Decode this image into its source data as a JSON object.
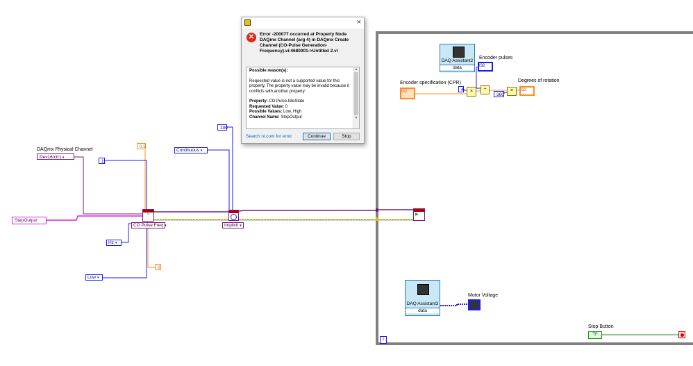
{
  "dialog": {
    "title": "",
    "close": "×",
    "error_icon": "error-x-icon",
    "message": "Error -200077 occurred at Property Node DAQmx Channel (arg 4) in DAQmx Create Channel (CO-Pulse Generation-Frequency).vi:4680001->Untitled 2.vi",
    "reasons_heading": "Possible reason(s):",
    "reason_text": "Requested value is not a supported value for this property. The property value may be invalid because it conflicts with another property.",
    "property_label": "Property:",
    "property_value": "CO.Pulse.IdleState",
    "requested_label": "Requested Value:",
    "requested_value": "0",
    "possible_label": "Possible Values:",
    "possible_value": "Low, High",
    "channel_label": "Channel Name:",
    "channel_value": "StepOutput",
    "search_link": "Search ni.com for error",
    "continue_button": "Continue",
    "stop_button": "Stop"
  },
  "diagram": {
    "physical_channel_label": "DAQmx Physical Channel",
    "physical_channel_value": "Dev16/ctr1",
    "step_output": "StepOutput",
    "const_05": "0.5",
    "const_1": "1",
    "hz_enum": "Hz",
    "low_enum": "Low",
    "const_0": "0",
    "co_pulse_freq": "CO Pulse Freq",
    "continuous": "Continuous",
    "const_100": "100",
    "implicit": "Implicit",
    "encoder_spec_label": "Encoder specification (CPR)",
    "encoder_spec_value": "I32",
    "const_4": "4",
    "const_360": "360",
    "daq_assistant2": "DAQ Assistant2",
    "daq_data": "data",
    "encoder_pulses_label": "Encoder pulses",
    "degrees_label": "Degrees of rotation",
    "indicator_value": "I32",
    "daq_assistant3": "DAQ Assistant3",
    "motor_voltage_label": "Motor Voltage",
    "stop_button_label": "Stop Button",
    "stop_button_value": "TF",
    "loop_iteration": "i"
  },
  "colors": {
    "wire_daqmx": "#7a1a7a",
    "wire_error": "#d4c000",
    "wire_numeric_orange": "#ff8c1a",
    "wire_int_blue": "#1a1aff",
    "wire_string_pink": "#e020e0",
    "loop_border": "#808080",
    "error_red": "#d62c1a"
  }
}
